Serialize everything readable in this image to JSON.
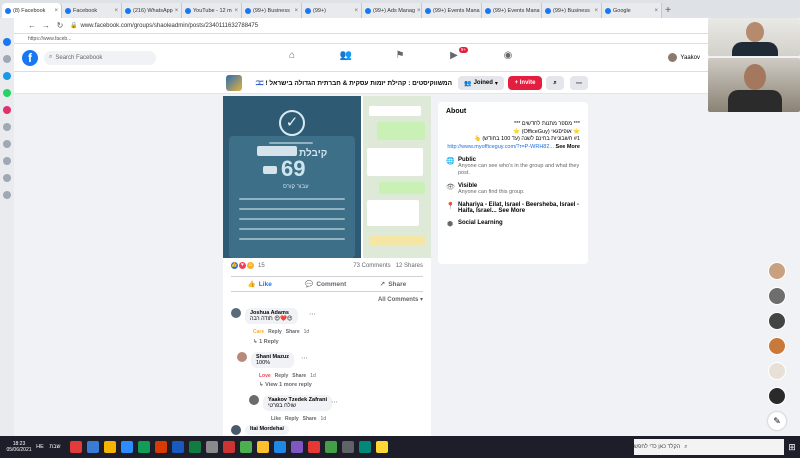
{
  "browser": {
    "tabs": [
      {
        "label": "(8) Facebook"
      },
      {
        "label": "Facebook"
      },
      {
        "label": "(216) WhatsApp"
      },
      {
        "label": "YouTube - 12 m"
      },
      {
        "label": "(99+) Business"
      },
      {
        "label": "(99+)"
      },
      {
        "label": "(99+) Ads Manag"
      },
      {
        "label": "(99+) Events Mana"
      },
      {
        "label": "(99+) Events Mana"
      },
      {
        "label": "(99+) Business"
      },
      {
        "label": "Google"
      }
    ],
    "url": "www.facebook.com/groups/shaoleadmin/posts/2340111632788475",
    "bookmark": "https://www.faceb...",
    "colors": {
      "chrome": "#dee1e6",
      "tab_active": "#ffffff"
    }
  },
  "fb": {
    "logo": "f",
    "search_placeholder": "Search Facebook",
    "user_name": "Yaakov",
    "notif_badge": "9+",
    "brand_color": "#1877f2",
    "nav_icons": [
      "home-icon",
      "people-icon",
      "flag-icon",
      "watch-icon",
      "groups-icon"
    ]
  },
  "group": {
    "name": "המשווקיסטים : קהילת יזמות עסקית & חברתית הגדולה בישראל ! 🇮🇱",
    "joined_label": "Joined",
    "invite_label": "+ Invite",
    "search_icon": "search-icon",
    "more_icon": "more-icon"
  },
  "post": {
    "image_text": {
      "big_number": "69",
      "caption_he": "קיבלת",
      "sub_he": "עבור קורס",
      "top_he": "מעולה בעסק"
    },
    "reaction_count": "15",
    "comments_label": "73 Comments",
    "shares_label": "12 Shares",
    "like_label": "Like",
    "comment_label": "Comment",
    "share_label": "Share",
    "all_comments_label": "All Comments"
  },
  "comments": [
    {
      "name": "Joshua Adams",
      "text": "תודה רבה 😍❤️😍",
      "react": "Care",
      "reply": "Reply",
      "share": "Share",
      "time": "1d",
      "replies": "1 Reply"
    },
    {
      "name": "Shani Mazuz",
      "text": "100%",
      "react": "Love",
      "reply": "Reply",
      "share": "Share",
      "time": "1d",
      "replies": "View 1 more reply"
    },
    {
      "name": "Yaakov Tzedek Zafrani",
      "text": "שולח בפרטי",
      "react": "Like",
      "reply": "Reply",
      "share": "Share",
      "time": "1d"
    },
    {
      "name": "Itai Mordehai",
      "text": ""
    }
  ],
  "about": {
    "title": "About",
    "desc_line1": "*** מספר מתנות לחדשים ***",
    "desc_line2": "⭐ אופיסגאי (OfficeGuy) ⭐",
    "desc_line3": "#1 חשבוניות בחינם לשנה (עד 100 בחודש) 👆",
    "desc_link": "http://www.myofficeguy.com/?r=P-WRH82...",
    "see_more": "See More",
    "public_title": "Public",
    "public_sub": "Anyone can see who's in the group and what they post.",
    "visible_title": "Visible",
    "visible_sub": "Anyone can find this group.",
    "location": "Nahariya - Eilat, Israel - Beersheba, Israel - Haifa, Israel... See More",
    "category": "Social Learning"
  },
  "taskbar": {
    "time": "18:23",
    "date": "05/06/2021",
    "lang": "HE",
    "day": "שבת",
    "search_placeholder": "הקלד כאן כדי לחפש"
  }
}
